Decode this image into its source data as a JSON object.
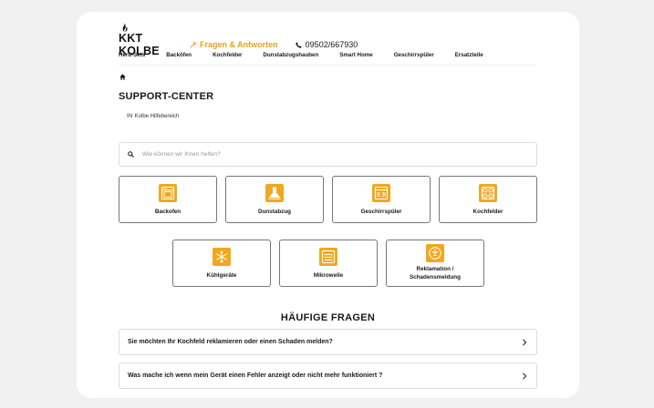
{
  "header": {
    "logo_text": "KKT KOLBE",
    "faq_link": "Fragen & Antworten",
    "phone": "09502/667930"
  },
  "nav": {
    "items": [
      {
        "label": "Herd-Sets"
      },
      {
        "label": "Backöfen"
      },
      {
        "label": "Kochfelder"
      },
      {
        "label": "Dunstabzugshauben"
      },
      {
        "label": "Smart Home"
      },
      {
        "label": "Geschirrspüler"
      },
      {
        "label": "Ersatzteile"
      }
    ]
  },
  "page": {
    "title": "SUPPORT-CENTER",
    "subtitle": "Ihr Kolbe Hilfebereich"
  },
  "search": {
    "placeholder": "Wie können wir Ihnen helfen?"
  },
  "categories": [
    {
      "label": "Backofen",
      "icon": "oven-icon"
    },
    {
      "label": "Dunstabzug",
      "icon": "hood-icon"
    },
    {
      "label": "Geschirrspüler",
      "icon": "dishwasher-icon"
    },
    {
      "label": "Kochfelder",
      "icon": "cooktop-icon"
    },
    {
      "label": "Kühlgeräte",
      "icon": "snowflake-icon"
    },
    {
      "label": "Mikrowelle",
      "icon": "microwave-icon"
    },
    {
      "label": "Reklamation /",
      "label2": "Schadensmeldung",
      "icon": "complaint-icon"
    }
  ],
  "faq": {
    "title": "HÄUFIGE FRAGEN",
    "items": [
      {
        "question": "Sie möchten Ihr Kochfeld reklamieren oder einen Schaden melden?"
      },
      {
        "question": "Was mache ich wenn mein Gerät einen Fehler anzeigt oder nicht mehr funktioniert ?"
      }
    ]
  },
  "colors": {
    "accent": "#f0a81f",
    "background": "#f1f1f1"
  }
}
